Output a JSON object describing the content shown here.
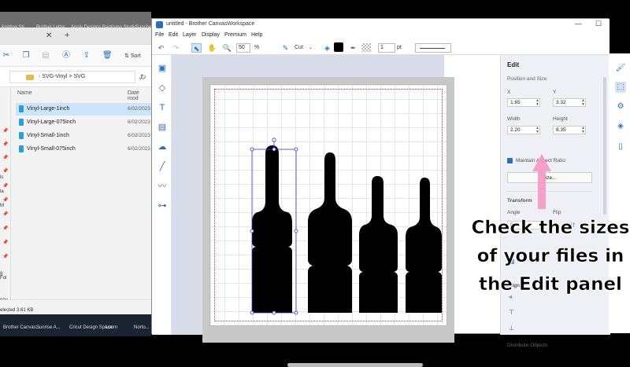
{
  "desktop_top": {
    "labels": [
      "Knitting Sti...",
      "Brother Lettre...",
      "Anniv Designs",
      "Baptismo Studio",
      "Sanchez"
    ]
  },
  "explorer": {
    "sort_label": "Sort",
    "address": {
      "parts": [
        "SVG-Vinyl",
        ">",
        "SVG"
      ]
    },
    "columns": {
      "name": "Name",
      "date": "Date mod"
    },
    "files": [
      {
        "name": "Vinyl-Large-1inch",
        "date": "6/02/2023",
        "selected": true
      },
      {
        "name": "Vinyl-Large-075inch",
        "date": "6/02/2023",
        "selected": false
      },
      {
        "name": "Vinyl-Small-1inch",
        "date": "6/02/2023",
        "selected": false
      },
      {
        "name": "Vinyl-Small-075inch",
        "date": "6/02/2023",
        "selected": false
      }
    ],
    "left_labels": [
      "ls",
      "la",
      "M",
      "g Fol",
      "opy"
    ],
    "status": "elected  3.61 KB"
  },
  "taskbar": {
    "items": [
      "Brother Canvas...",
      "Sunrise A...",
      "Cricut Design Space",
      "Loom",
      "Norto..."
    ]
  },
  "app": {
    "title": "untitled - Brother CanvasWorkspace",
    "menu": [
      "File",
      "Edit",
      "Layer",
      "Display",
      "Premium",
      "Help"
    ],
    "toolbar": {
      "zoom": "50",
      "zoom_unit": "%",
      "mode": "Cut",
      "line_width": "1",
      "line_unit": "pt",
      "fill_color": "#000000"
    },
    "panel": {
      "title": "Edit",
      "position_size": "Position and Size",
      "x_label": "X",
      "x_value": "1.65",
      "y_label": "Y",
      "y_value": "3.32",
      "width_label": "Width",
      "width_value": "2.20",
      "height_label": "Height",
      "height_value": "8.35",
      "aspect_label": "Maintain Aspect Ratio",
      "resize_label": "size...",
      "transform_label": "Transform",
      "angle_label": "Angle",
      "angle_value": "0",
      "flip_label": "Flip",
      "align_label": "Align",
      "distribute_label": "Distribute Objects"
    }
  },
  "overlay": {
    "caption_lines": [
      "Check the sizes",
      "of your files in",
      "the Edit panel"
    ]
  },
  "chart_data": null
}
